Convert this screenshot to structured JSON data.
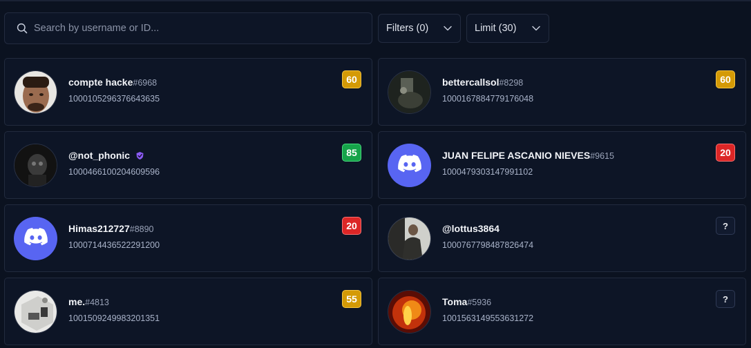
{
  "search": {
    "placeholder": "Search by username or ID..."
  },
  "filters": {
    "label": "Filters (0)"
  },
  "limit": {
    "label": "Limit (30)"
  },
  "colors": {
    "accent_discord": "#5865f2",
    "score_yellow": "#d49a06",
    "score_green": "#16a34a",
    "score_red": "#dc2626"
  },
  "users": [
    {
      "username": "compte hacke",
      "discriminator": "#6968",
      "id": "1000105296376643635",
      "score": "60",
      "score_color": "yellow",
      "avatar": "photo-face",
      "verified": false
    },
    {
      "username": "bettercallsol",
      "discriminator": "#8298",
      "id": "1000167884779176048",
      "score": "60",
      "score_color": "yellow",
      "avatar": "photo-dark-room",
      "verified": false
    },
    {
      "username": "@not_phonic",
      "discriminator": "",
      "id": "1000466100204609596",
      "score": "85",
      "score_color": "green",
      "avatar": "photo-dark-figure",
      "verified": true
    },
    {
      "username": "JUAN FELIPE ASCANIO NIEVES",
      "discriminator": "#9615",
      "id": "1000479303147991102",
      "score": "20",
      "score_color": "red",
      "avatar": "discord-logo",
      "verified": false
    },
    {
      "username": "Himas212727",
      "discriminator": "#8890",
      "id": "1000714436522291200",
      "score": "20",
      "score_color": "red",
      "avatar": "discord-logo",
      "verified": false
    },
    {
      "username": "@lottus3864",
      "discriminator": "",
      "id": "1000767798487826474",
      "score": "?",
      "score_color": "unknown",
      "avatar": "photo-person",
      "verified": false
    },
    {
      "username": "me.",
      "discriminator": "#4813",
      "id": "1001509249983201351",
      "score": "55",
      "score_color": "yellow",
      "avatar": "photo-room",
      "verified": false
    },
    {
      "username": "Toma",
      "discriminator": "#5936",
      "id": "1001563149553631272",
      "score": "?",
      "score_color": "unknown",
      "avatar": "photo-fire",
      "verified": false
    }
  ]
}
